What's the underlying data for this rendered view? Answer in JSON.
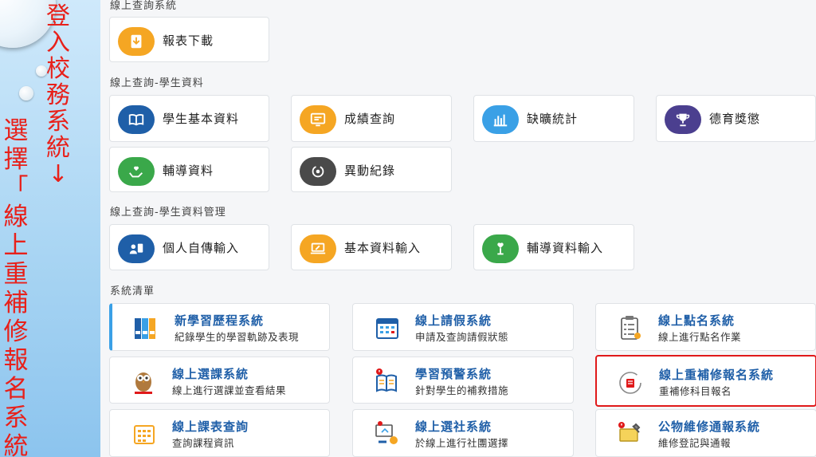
{
  "slide": {
    "line1": [
      "登",
      "入",
      "校",
      "務",
      "系",
      "統",
      "↓"
    ],
    "line2": [
      "選",
      "擇",
      "「",
      "線",
      "上",
      "重",
      "補",
      "修",
      "報",
      "名",
      "系",
      "統"
    ]
  },
  "sections": {
    "s0": "線上查詢系統",
    "s1": "線上查詢-學生資料",
    "s2": "線上查詢-學生資料管理",
    "s3": "系統清單"
  },
  "tiles": {
    "report": {
      "label": "報表下載",
      "color": "#f5a623",
      "icon": "download-icon"
    },
    "student_info": {
      "label": "學生基本資料",
      "color": "#1f5fa8",
      "icon": "book-icon"
    },
    "grades": {
      "label": "成績查詢",
      "color": "#f5a623",
      "icon": "monitor-icon"
    },
    "absence": {
      "label": "缺曠統計",
      "color": "#3aa0e6",
      "icon": "bar-chart-icon"
    },
    "merit": {
      "label": "德育獎懲",
      "color": "#4b3f8f",
      "icon": "trophy-icon"
    },
    "counsel": {
      "label": "輔導資料",
      "color": "#3aa84a",
      "icon": "hands-heart-icon"
    },
    "change": {
      "label": "異動紀錄",
      "color": "#4a4a4a",
      "icon": "refresh-icon"
    },
    "autobio": {
      "label": "個人自傳輸入",
      "color": "#1f5fa8",
      "icon": "person-doc-icon"
    },
    "basic_input": {
      "label": "基本資料輸入",
      "color": "#f5a623",
      "icon": "laptop-pen-icon"
    },
    "counsel_input": {
      "label": "輔導資料輸入",
      "color": "#3aa84a",
      "icon": "heart-plant-icon"
    }
  },
  "systems": {
    "portfolio": {
      "title": "新學習歷程系統",
      "desc": "紀錄學生的學習軌跡及表現"
    },
    "leave": {
      "title": "線上請假系統",
      "desc": "申請及查詢請假狀態"
    },
    "rollcall": {
      "title": "線上點名系統",
      "desc": "線上進行點名作業"
    },
    "course_select": {
      "title": "線上選課系統",
      "desc": "線上進行選課並查看結果"
    },
    "warning": {
      "title": "學習預警系統",
      "desc": "針對學生的補救措施"
    },
    "retake": {
      "title": "線上重補修報名系統",
      "desc": "重補修科目報名"
    },
    "timetable": {
      "title": "線上課表查詢",
      "desc": "查詢課程資訊"
    },
    "club": {
      "title": "線上選社系統",
      "desc": "於線上進行社團選擇"
    },
    "repair": {
      "title": "公物維修通報系統",
      "desc": "維修登記與通報"
    }
  }
}
